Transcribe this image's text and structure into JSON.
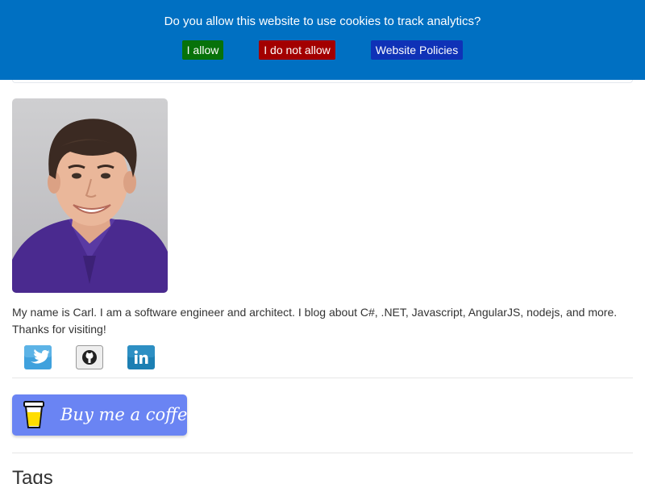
{
  "cookie_banner": {
    "message": "Do you allow this website to use cookies to track analytics?",
    "allow_label": "I allow",
    "deny_label": "I do not allow",
    "policy_label": "Website Policies",
    "colors": {
      "background": "#0070c2",
      "allow": "#07720a",
      "deny": "#a30000",
      "policy": "#0f32b7"
    }
  },
  "profile": {
    "photo_icon": "profile-photo",
    "bio": "My name is Carl. I am a software engineer and architect. I blog about C#, .NET, Javascript, AngularJS, nodejs, and more. Thanks for visiting!"
  },
  "social": [
    {
      "icon": "twitter-icon",
      "color": "#3fa1dd"
    },
    {
      "icon": "github-icon",
      "color": "#e8e8e8"
    },
    {
      "icon": "linkedin-icon",
      "color": "#1c7fb3"
    }
  ],
  "coffee_button": {
    "label": "Buy me a coffee",
    "color": "#6a84f3"
  },
  "tags": {
    "heading": "Tags"
  }
}
